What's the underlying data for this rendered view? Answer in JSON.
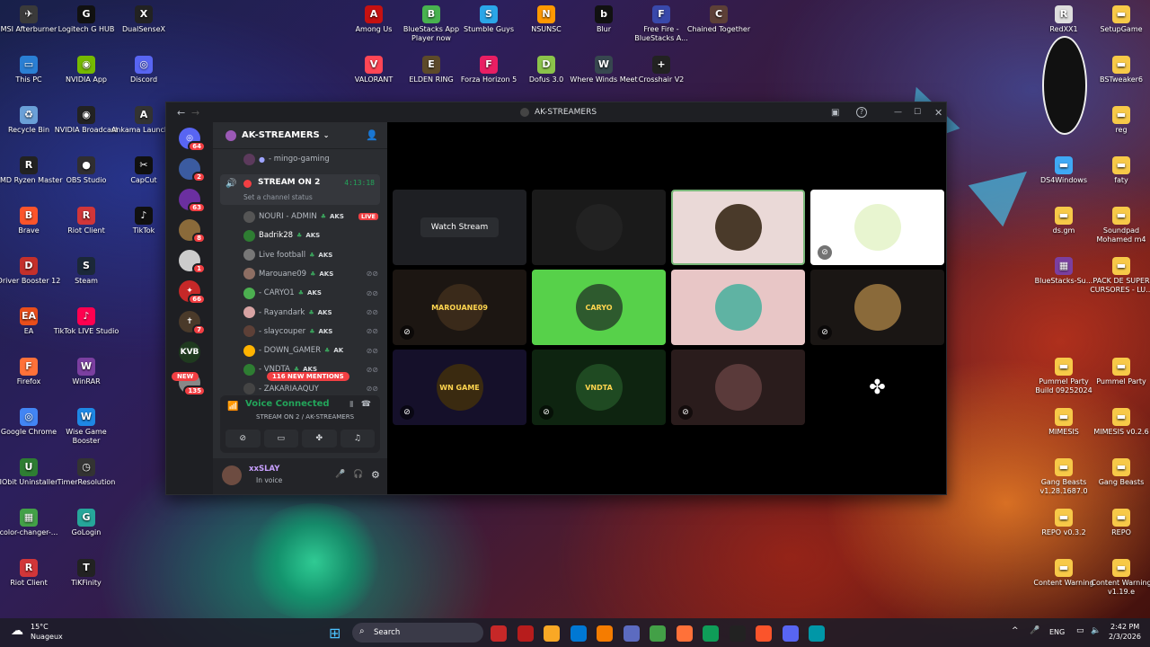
{
  "desktop_left": [
    {
      "label": "MSI Afterburner",
      "c": "#3a3a3a",
      "g": "✈"
    },
    {
      "label": "Logitech G HUB",
      "c": "#111",
      "g": "G"
    },
    {
      "label": "DualSenseX",
      "c": "#222",
      "g": "X"
    },
    {
      "label": "This PC",
      "c": "#2a7fd4",
      "g": "▭"
    },
    {
      "label": "NVIDIA App",
      "c": "#76b900",
      "g": "◉"
    },
    {
      "label": "Discord",
      "c": "#5865f2",
      "g": "◎"
    },
    {
      "label": "Recycle Bin",
      "c": "#6aa0d8",
      "g": "♻"
    },
    {
      "label": "NVIDIA Broadcast",
      "c": "#222",
      "g": "◉"
    },
    {
      "label": "Ankama Launcher",
      "c": "#333",
      "g": "A"
    },
    {
      "label": "AMD Ryzen Master",
      "c": "#222",
      "g": "R"
    },
    {
      "label": "OBS Studio",
      "c": "#302e31",
      "g": "●"
    },
    {
      "label": "CapCut",
      "c": "#111",
      "g": "✂"
    },
    {
      "label": "Brave",
      "c": "#fb542b",
      "g": "B"
    },
    {
      "label": "Riot Client",
      "c": "#d13639",
      "g": "R"
    },
    {
      "label": "TikTok",
      "c": "#111",
      "g": "♪"
    },
    {
      "label": "Driver Booster 12",
      "c": "#c4302b",
      "g": "D"
    },
    {
      "label": "Steam",
      "c": "#1b2838",
      "g": "S"
    },
    {
      "label": "EA",
      "c": "#e94e1b",
      "g": "EA"
    },
    {
      "label": "TikTok LIVE Studio",
      "c": "#ff0050",
      "g": "♪"
    },
    {
      "label": "Firefox",
      "c": "#ff7139",
      "g": "F"
    },
    {
      "label": "WinRAR",
      "c": "#7b3fa0",
      "g": "W"
    },
    {
      "label": "Google Chrome",
      "c": "#4285f4",
      "g": "◎"
    },
    {
      "label": "Wise Game Booster",
      "c": "#1e88e5",
      "g": "W"
    },
    {
      "label": "IObit Uninstaller",
      "c": "#2e7d32",
      "g": "U"
    },
    {
      "label": "TimerResolution",
      "c": "#333",
      "g": "◷"
    },
    {
      "label": "color-changer-...",
      "c": "#43a047",
      "g": "▦"
    },
    {
      "label": "GoLogin",
      "c": "#26a69a",
      "g": "G"
    },
    {
      "label": "Riot Client",
      "c": "#d13639",
      "g": "R"
    },
    {
      "label": "TiKFinity",
      "c": "#222",
      "g": "T"
    }
  ],
  "desktop_top": [
    {
      "label": "Among Us",
      "c": "#c51111",
      "g": "A"
    },
    {
      "label": "BlueStacks App Player now",
      "c": "#48b24f",
      "g": "B"
    },
    {
      "label": "Stumble Guys",
      "c": "#2aa6e8",
      "g": "S"
    },
    {
      "label": "NSUNSC",
      "c": "#ff9800",
      "g": "N"
    },
    {
      "label": "Blur",
      "c": "#111",
      "g": "b"
    },
    {
      "label": "Free Fire - BlueStacks A...",
      "c": "#3949ab",
      "g": "F"
    },
    {
      "label": "Chained Together",
      "c": "#5d4037",
      "g": "C"
    },
    {
      "label": "VALORANT",
      "c": "#ff4655",
      "g": "V"
    },
    {
      "label": "ELDEN RING",
      "c": "#5d4a2a",
      "g": "E"
    },
    {
      "label": "Forza Horizon 5",
      "c": "#e91e63",
      "g": "F"
    },
    {
      "label": "Dofus 3.0",
      "c": "#8bc34a",
      "g": "D"
    },
    {
      "label": "Where Winds Meet",
      "c": "#37474f",
      "g": "W"
    },
    {
      "label": "Crosshair V2",
      "c": "#222",
      "g": "+"
    }
  ],
  "desktop_right": [
    {
      "label": "RedXX1",
      "c": "#ddd",
      "g": "R"
    },
    {
      "label": "SetupGame",
      "c": "#f7c948",
      "g": "▬"
    },
    {
      "label": "BSTweaker6",
      "c": "#f7c948",
      "g": "▬"
    },
    {
      "label": "reg",
      "c": "#f7c948",
      "g": "▬"
    },
    {
      "label": "DS4Windows",
      "c": "#3fa9f5",
      "g": "▬"
    },
    {
      "label": "faty",
      "c": "#f7c948",
      "g": "▬"
    },
    {
      "label": "ds.gm",
      "c": "#f7c948",
      "g": "▬"
    },
    {
      "label": "Soundpad Mohamed m4",
      "c": "#f7c948",
      "g": "▬"
    },
    {
      "label": "BlueStacks-Su...",
      "c": "#7b3fa0",
      "g": "▦"
    },
    {
      "label": "PACK DE SUPER CURSORES - LU...",
      "c": "#f7c948",
      "g": "▬"
    },
    {
      "label": "Pummel Party Build 09252024",
      "c": "#f7c948",
      "g": "▬"
    },
    {
      "label": "Pummel Party",
      "c": "#f7c948",
      "g": "▬"
    },
    {
      "label": "MIMESIS",
      "c": "#f7c948",
      "g": "▬"
    },
    {
      "label": "MIMESIS v0.2.6",
      "c": "#f7c948",
      "g": "▬"
    },
    {
      "label": "Gang Beasts v1.28.1687.0",
      "c": "#f7c948",
      "g": "▬"
    },
    {
      "label": "Gang Beasts",
      "c": "#f7c948",
      "g": "▬"
    },
    {
      "label": "REPO v0.3.2",
      "c": "#f7c948",
      "g": "▬"
    },
    {
      "label": "REPO",
      "c": "#f7c948",
      "g": "▬"
    },
    {
      "label": "Content Warning",
      "c": "#f7c948",
      "g": "▬"
    },
    {
      "label": "Content Warning v1.19.e",
      "c": "#f7c948",
      "g": "▬"
    }
  ],
  "window": {
    "title": "AK-STREAMERS"
  },
  "servers": [
    {
      "badge": "64",
      "c": "#5865f2",
      "g": "◎"
    },
    {
      "badge": "2",
      "c": "#3b5ba0",
      "g": ""
    },
    {
      "badge": "63",
      "c": "#6b2fa0",
      "g": ""
    },
    {
      "badge": "8",
      "c": "#8a6a3a",
      "g": ""
    },
    {
      "badge": "1",
      "c": "#ccc",
      "g": ""
    },
    {
      "badge": "66",
      "c": "#c62828",
      "g": "✦"
    },
    {
      "badge": "7",
      "c": "#4a3a2a",
      "g": "✝"
    },
    {
      "badge": "",
      "c": "#1f3a1f",
      "g": "KVB"
    },
    {
      "badge": "135",
      "c": "#888",
      "g": ""
    }
  ],
  "new_label": "NEW",
  "server_name": "AK-STREAMERS",
  "channel": {
    "top_user": "- mingo-gaming",
    "name": "STREAM ON 2",
    "timer": "4:13:18",
    "status_placeholder": "Set a channel status"
  },
  "members": [
    {
      "name": "NOURI - ADMIN",
      "tag": "AKS",
      "live": "LIVE",
      "c": "#555"
    },
    {
      "name": "Badrik28",
      "tag": "AKS",
      "c": "#2e7d32",
      "white": true
    },
    {
      "name": "Live football",
      "tag": "AKS",
      "c": "#777"
    },
    {
      "name": "Marouane09",
      "tag": "AKS",
      "c": "#8d6e63"
    },
    {
      "name": "- CARYO1",
      "tag": "AKS",
      "c": "#4caf50"
    },
    {
      "name": "- Rayandark",
      "tag": "AKS",
      "c": "#d7a3a3"
    },
    {
      "name": "- slaycouper",
      "tag": "AKS",
      "c": "#5d4037"
    },
    {
      "name": "- DOWN_GAMER",
      "tag": "AK",
      "c": "#ffb300"
    },
    {
      "name": "- VNDTA",
      "tag": "AKS",
      "c": "#2e7d32"
    },
    {
      "name": "- ZAKARIAAQUY",
      "tag": "",
      "c": "#444"
    }
  ],
  "mentions_label": "116 NEW MENTIONS",
  "voice": {
    "title": "Voice Connected",
    "subtitle": "STREAM ON 2 / AK-STREAMERS"
  },
  "me": {
    "name": "xxSLAY",
    "status": "In voice"
  },
  "grid": {
    "watch_stream": "Watch Stream",
    "tiles": [
      {
        "bg": "#1a1a1a",
        "av": "#222",
        "t": ""
      },
      {
        "bg": "#ead9d7",
        "av": "#4a3a2a",
        "t": ""
      },
      {
        "bg": "#ffffff",
        "av": "#e8f5d0",
        "t": ""
      },
      {
        "bg": "#1c1612",
        "av": "#3a2a1a",
        "t": "MAROUANE09"
      },
      {
        "bg": "#57d14a",
        "av": "#2e5a2e",
        "t": "CARYO"
      },
      {
        "bg": "#e8c6c6",
        "av": "#5fb3a3",
        "t": ""
      },
      {
        "bg": "#1a1614",
        "av": "#8a6a3a",
        "t": ""
      },
      {
        "bg": "#15102a",
        "av": "#3a2a10",
        "t": "WN GAME"
      },
      {
        "bg": "#0e2410",
        "av": "#1f4a22",
        "t": "VNDTA"
      },
      {
        "bg": "#2a1c1c",
        "av": "#5a3a3a",
        "t": ""
      }
    ]
  },
  "taskbar": {
    "temp": "15°C",
    "weather": "Nuageux",
    "search": "Search",
    "lang": "ENG",
    "time": "2:42 PM",
    "date": "2/3/2026"
  }
}
